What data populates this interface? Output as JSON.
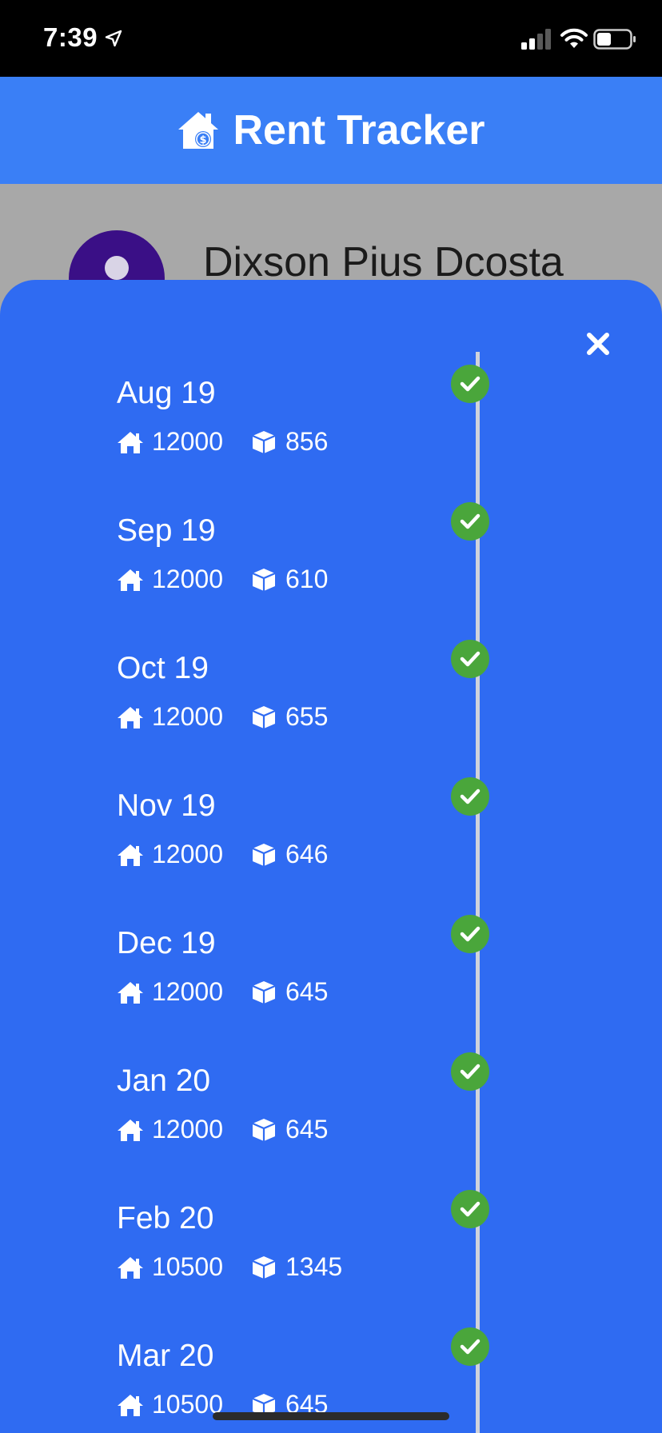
{
  "status_bar": {
    "time": "7:39"
  },
  "header": {
    "title": "Rent Tracker",
    "logo_icon": "house-dollar-icon",
    "background": "#3a7ff6"
  },
  "profile": {
    "name": "Dixson Pius Dcosta",
    "avatar_color": "#3a0f86"
  },
  "sheet": {
    "background": "#2f6bf2",
    "close_icon": "close-icon",
    "entries": [
      {
        "month": "Aug 19",
        "rent": "12000",
        "utility": "856",
        "paid": true
      },
      {
        "month": "Sep 19",
        "rent": "12000",
        "utility": "610",
        "paid": true
      },
      {
        "month": "Oct 19",
        "rent": "12000",
        "utility": "655",
        "paid": true
      },
      {
        "month": "Nov 19",
        "rent": "12000",
        "utility": "646",
        "paid": true
      },
      {
        "month": "Dec 19",
        "rent": "12000",
        "utility": "645",
        "paid": true
      },
      {
        "month": "Jan 20",
        "rent": "12000",
        "utility": "645",
        "paid": true
      },
      {
        "month": "Feb 20",
        "rent": "10500",
        "utility": "1345",
        "paid": true
      },
      {
        "month": "Mar 20",
        "rent": "10500",
        "utility": "645",
        "paid": true
      }
    ]
  },
  "colors": {
    "paid_check": "#4aa63b",
    "timeline": "#d0d3db"
  }
}
